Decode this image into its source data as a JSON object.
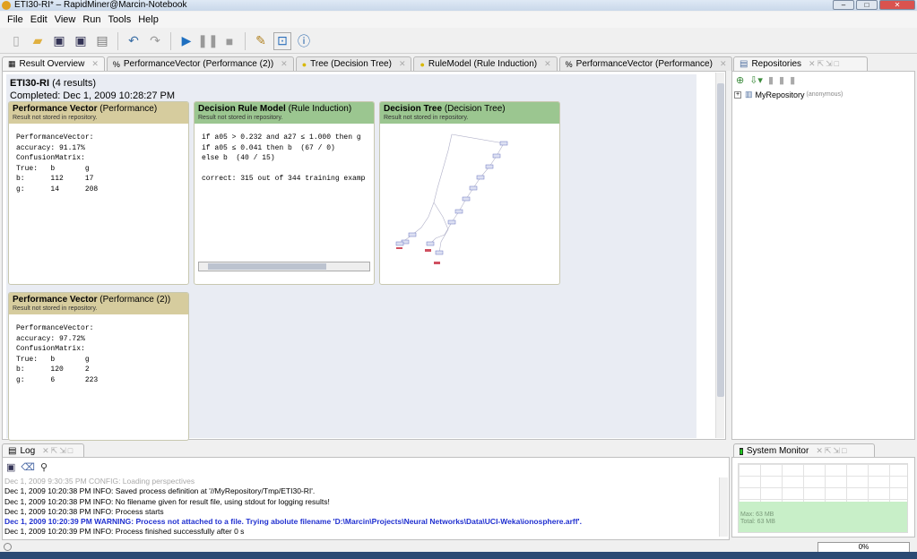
{
  "window": {
    "title": "ETI30-RI* – RapidMiner@Marcin-Notebook"
  },
  "menu": [
    "File",
    "Edit",
    "View",
    "Run",
    "Tools",
    "Help"
  ],
  "toolbar_icons": [
    "new-icon",
    "open-icon",
    "save-icon",
    "save-as-icon",
    "save-all-icon",
    "undo-icon",
    "redo-icon",
    "run-icon",
    "pause-icon",
    "stop-icon",
    "edit-icon",
    "perspective-icon",
    "info-icon"
  ],
  "tabs": [
    {
      "label": "Result Overview",
      "icon": "overview-icon",
      "active": true
    },
    {
      "label": "PerformanceVector (Performance (2))",
      "icon": "performance-icon"
    },
    {
      "label": "Tree (Decision Tree)",
      "icon": "bulb-icon"
    },
    {
      "label": "RuleModel (Rule Induction)",
      "icon": "bulb-icon"
    },
    {
      "label": "PerformanceVector (Performance)",
      "icon": "performance-icon"
    }
  ],
  "overview": {
    "title": "ETI30-RI",
    "count": "(4 results)",
    "completed": "Completed: Dec 1, 2009 10:28:27 PM"
  },
  "cards": {
    "perf1": {
      "name": "Performance Vector",
      "type": "(Performance)",
      "note": "Result not stored in repository.",
      "body": "PerformanceVector:\naccuracy: 91.17%\nConfusionMatrix:\nTrue:   b       g\nb:      112     17\ng:      14      208"
    },
    "rule": {
      "name": "Decision Rule Model",
      "type": "(Rule Induction)",
      "note": "Result not stored in repository.",
      "body": "if a05 > 0.232 and a27 ≤ 1.000 then g\nif a05 ≤ 0.041 then b  (67 / 0)\nelse b  (40 / 15)\n\ncorrect: 315 out of 344 training examp"
    },
    "tree": {
      "name": "Decision Tree",
      "type": "(Decision Tree)",
      "note": "Result not stored in repository."
    },
    "perf2": {
      "name": "Performance Vector",
      "type": "(Performance (2))",
      "note": "Result not stored in repository.",
      "body": "PerformanceVector:\naccuracy: 97.72%\nConfusionMatrix:\nTrue:   b       g\nb:      120     2\ng:      6       223"
    }
  },
  "repositories": {
    "title": "Repositories",
    "item": "MyRepository",
    "item_note": "(anonymous)"
  },
  "log": {
    "title": "Log",
    "lines": [
      {
        "text": "Dec 1, 2009 9:30:35 PM CONFIG: Loading perspectives",
        "style": "faded"
      },
      {
        "text": "Dec 1, 2009 10:20:38 PM INFO: Saved process definition at '//MyRepository/Tmp/ETI30-RI'.",
        "style": ""
      },
      {
        "text": "Dec 1, 2009 10:20:38 PM INFO: No filename given for result file, using stdout for logging results!",
        "style": ""
      },
      {
        "text": "Dec 1, 2009 10:20:38 PM INFO: Process starts",
        "style": ""
      },
      {
        "text": "Dec 1, 2009 10:20:39 PM WARNING: Process not attached to a file. Trying abolute filename 'D:\\Marcin\\Projects\\Neural Networks\\Data\\UCI-Weka\\ionosphere.arff'.",
        "style": "warn"
      },
      {
        "text": "Dec 1, 2009 10:20:39 PM INFO: Process finished successfully after 0 s",
        "style": ""
      }
    ]
  },
  "system_monitor": {
    "title": "System Monitor",
    "max": "Max: 63 MB",
    "total": "Total: 63 MB",
    "memory_used_fraction": 0.45
  },
  "status": {
    "progress": "0%"
  }
}
